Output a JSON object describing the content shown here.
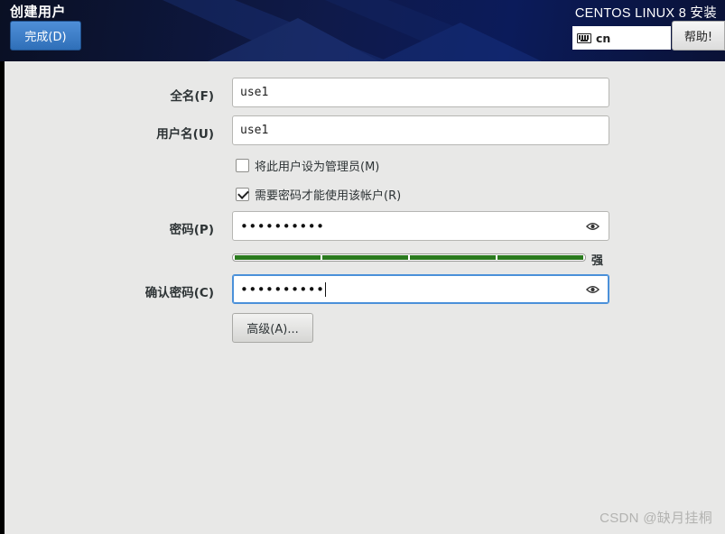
{
  "header": {
    "page_title": "创建用户",
    "done_button": "完成(D)",
    "product_title": "CENTOS LINUX 8 安装",
    "keyboard_layout": "cn",
    "help_button": "帮助!"
  },
  "form": {
    "fullname_label": "全名(F)",
    "fullname_value": "use1",
    "username_label": "用户名(U)",
    "username_value": "use1",
    "admin_checkbox": {
      "label": "将此用户设为管理员(M)",
      "checked": false
    },
    "require_password_checkbox": {
      "label": "需要密码才能使用该帐户(R)",
      "checked": true
    },
    "password_label": "密码(P)",
    "password_mask": "••••••••••",
    "strength": {
      "segments_filled": 4,
      "segments_total": 4,
      "label": "强",
      "color": "#2a7a1e"
    },
    "confirm_label": "确认密码(C)",
    "confirm_mask": "••••••••••",
    "advanced_button": "高级(A)..."
  },
  "watermark": "CSDN @缺月挂桐",
  "colors": {
    "accent": "#4a90d9",
    "done_button": "#3a7cc8",
    "header_bg": "#0c1640"
  }
}
